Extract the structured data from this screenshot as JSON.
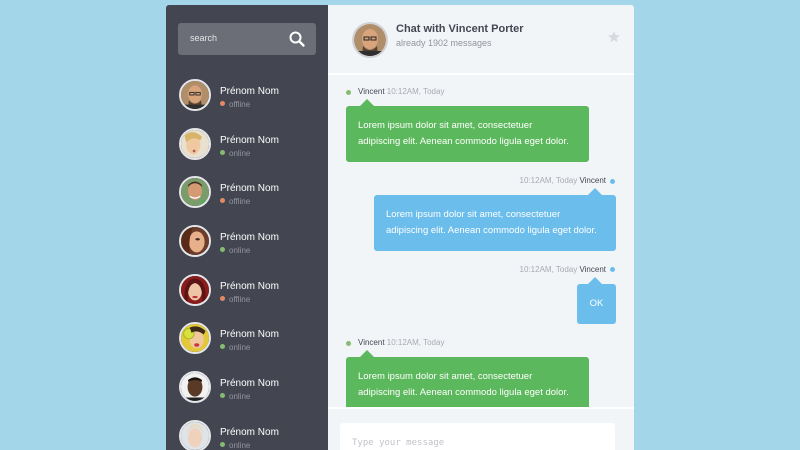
{
  "colors": {
    "page_background": "#a4d6e9",
    "sidebar_background": "#434651",
    "chat_background": "#f2f5f8",
    "online": "#86bb71",
    "offline": "#e38968",
    "me_bubble": "#5cb85c",
    "other_bubble": "#6bbdec"
  },
  "sidebar": {
    "search": {
      "placeholder": "search",
      "icon": "search-icon"
    },
    "people": [
      {
        "name": "Prénom Nom",
        "status": "offline"
      },
      {
        "name": "Prénom Nom",
        "status": "online"
      },
      {
        "name": "Prénom Nom",
        "status": "offline"
      },
      {
        "name": "Prénom Nom",
        "status": "online"
      },
      {
        "name": "Prénom Nom",
        "status": "offline"
      },
      {
        "name": "Prénom Nom",
        "status": "online"
      },
      {
        "name": "Prénom Nom",
        "status": "online"
      },
      {
        "name": "Prénom Nom",
        "status": "online"
      }
    ]
  },
  "chat": {
    "header": {
      "title": "Chat with Vincent Porter",
      "subtitle": "already 1902 messages",
      "star_icon": "star-icon"
    },
    "messages": [
      {
        "side": "left",
        "author": "Vincent",
        "time": "10:12AM, Today",
        "text": "Lorem ipsum dolor sit amet, consectetuer adipiscing elit. Aenean commodo ligula eget dolor."
      },
      {
        "side": "right",
        "author": "Vincent",
        "time": "10:12AM, Today",
        "text": "Lorem ipsum dolor sit amet, consectetuer adipiscing elit. Aenean commodo ligula eget dolor."
      },
      {
        "side": "right",
        "author": "Vincent",
        "time": "10:12AM, Today",
        "text": "OK"
      },
      {
        "side": "left",
        "author": "Vincent",
        "time": "10:12AM, Today",
        "text": "Lorem ipsum dolor sit amet, consectetuer adipiscing elit. Aenean commodo ligula eget dolor."
      }
    ],
    "compose": {
      "placeholder": "Type your message"
    }
  }
}
